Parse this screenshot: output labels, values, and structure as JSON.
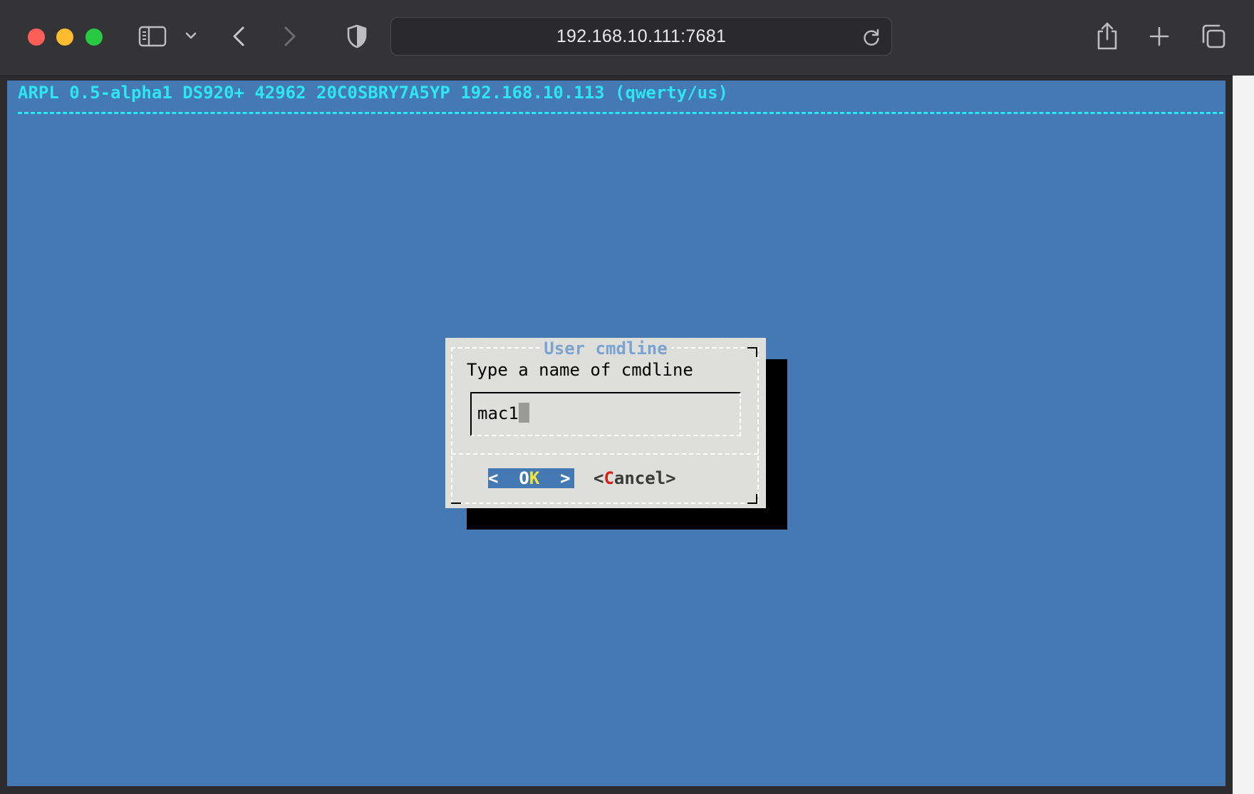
{
  "browser": {
    "address": "192.168.10.111:7681",
    "icons": {
      "sidebar": "sidebar-icon",
      "tab_menu": "chevron-down-icon",
      "back": "chevron-left-icon",
      "forward": "chevron-right-icon",
      "shield": "shield-icon",
      "reload": "reload-icon",
      "share": "share-icon",
      "new_tab": "plus-icon",
      "tabs": "tabs-overview-icon"
    }
  },
  "terminal": {
    "header": "ARPL 0.5-alpha1 DS920+ 42962 20C0SBRY7A5YP 192.168.10.113 (qwerty/us)",
    "colors": {
      "background": "#4579b3",
      "header": "#2ee6f0"
    }
  },
  "dialog": {
    "title": "User cmdline",
    "prompt": "Type a name of cmdline",
    "input_value": "mac1",
    "ok": {
      "left": "<  ",
      "hotkey": "O",
      "hot_second": "K",
      "right": "  >"
    },
    "cancel": {
      "open": "<",
      "hotkey": "C",
      "rest": "ancel",
      "close": ">"
    }
  }
}
